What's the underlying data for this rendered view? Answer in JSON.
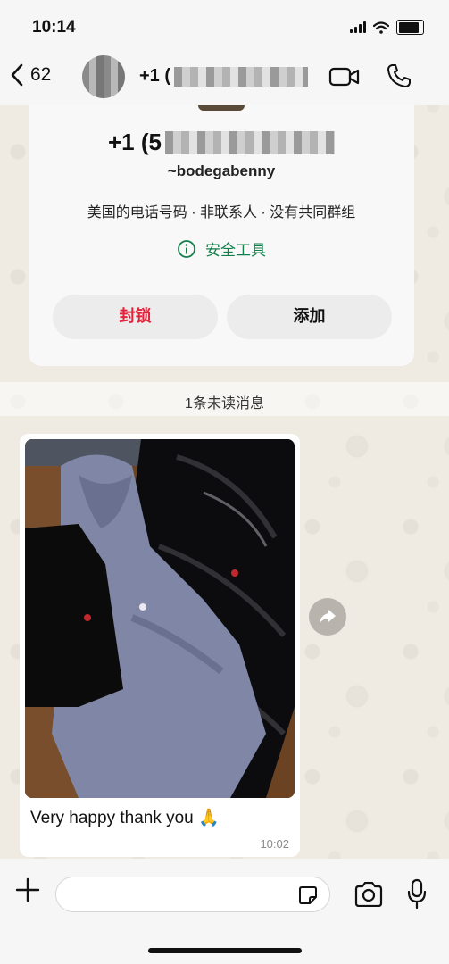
{
  "status_bar": {
    "time": "10:14"
  },
  "header": {
    "back_count": "62",
    "title_prefix": "+1 (",
    "icons": [
      "chevron-left-icon",
      "video-call-icon",
      "phone-icon"
    ]
  },
  "profile_card": {
    "phone_prefix": "+1 (5",
    "username": "~bodegabenny",
    "info": "美国的电话号码 · 非联系人 · 没有共同群组",
    "safety_tools": "安全工具",
    "block_label": "封锁",
    "add_label": "添加",
    "colors": {
      "block": "#e0243b",
      "safety": "#13804b"
    }
  },
  "unread": "1条未读消息",
  "message": {
    "text": "Very happy thank you 🙏",
    "time": "10:02",
    "image": "photo of grey and black Polo Ralph Lauren hoodies and a black puffer jacket on a wooden floor"
  },
  "input_bar": {
    "value": "",
    "icons": [
      "plus-icon",
      "sticker-icon",
      "camera-icon",
      "microphone-icon"
    ]
  }
}
